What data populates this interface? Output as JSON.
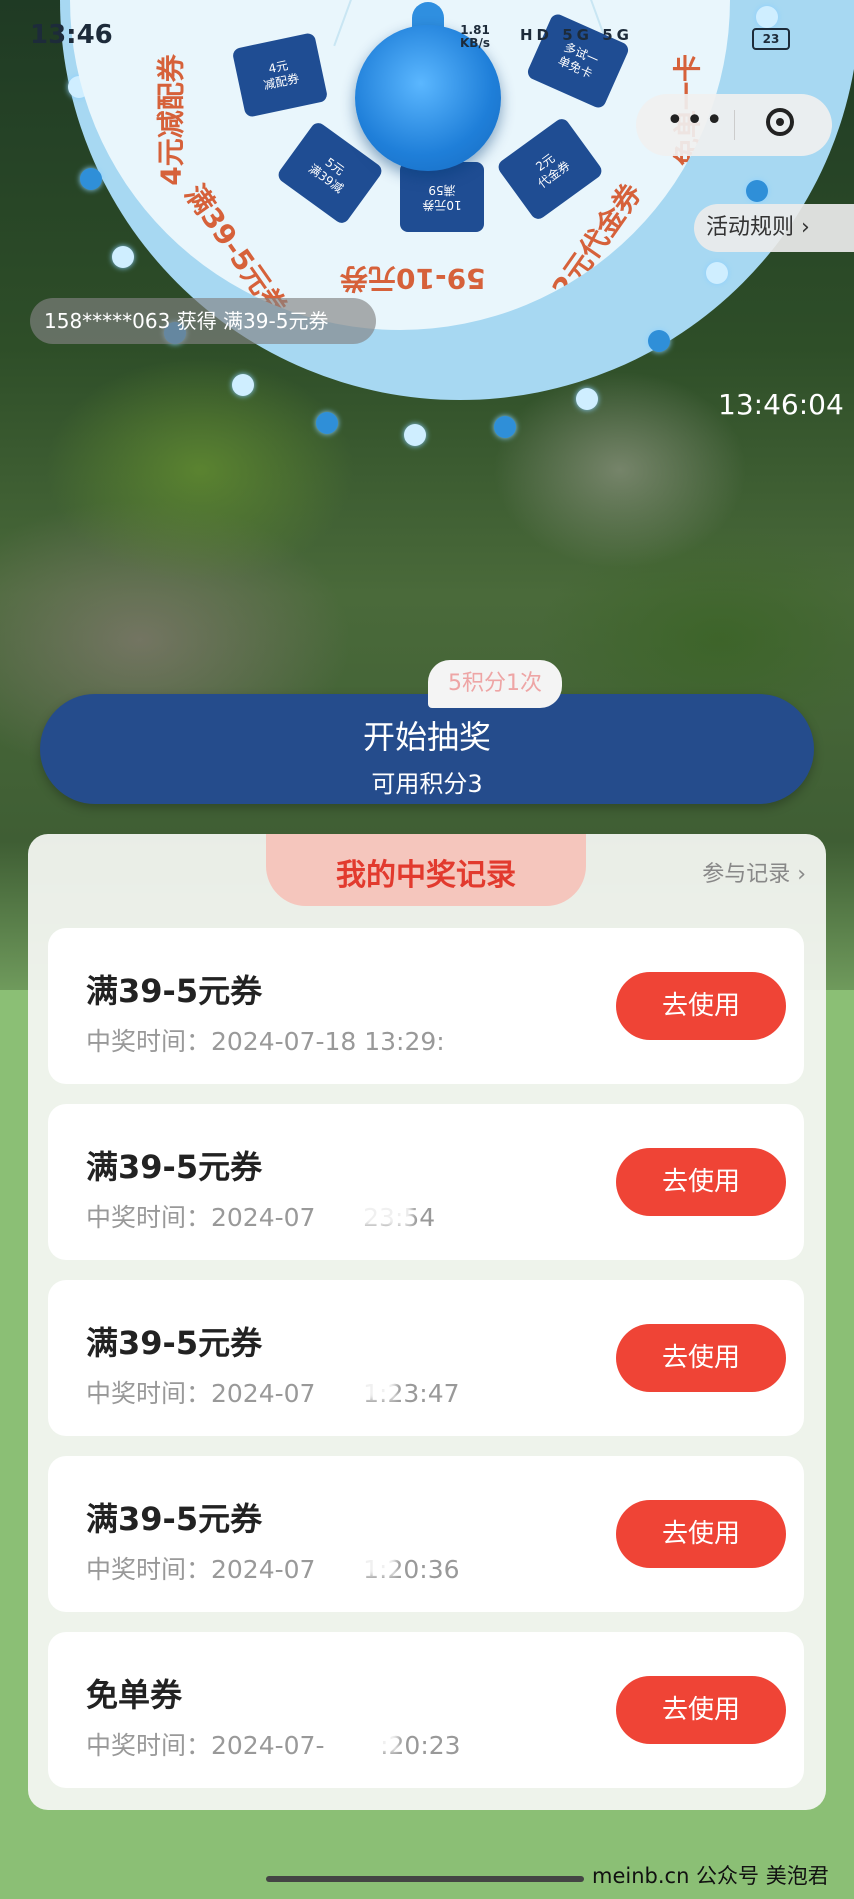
{
  "status_bar": {
    "time": "13:46",
    "net_speed": "1.81",
    "net_unit": "KB/s",
    "icons": "HD 5G 5G",
    "battery": "23"
  },
  "wheel": {
    "prizes": [
      {
        "text": "4元\n减配券"
      },
      {
        "text": "5元\n满39减"
      },
      {
        "text": "10元券\n满59"
      },
      {
        "text": "2元\n代金券"
      },
      {
        "text": "多试一\n单免卡"
      }
    ],
    "labels": [
      "4元减配券",
      "满39-5元券",
      "59-10元券",
      "2元代金券",
      "免单一卡"
    ]
  },
  "capsule": {
    "more": "•••"
  },
  "rules_label": "活动规则 ›",
  "ticker": "158*****063 获得 满39-5元券",
  "clock": "13:46:04",
  "draw": {
    "cost_tag": "5积分1次",
    "button_label": "开始抽奖",
    "points_text": "可用积分3"
  },
  "records": {
    "title": "我的中奖记录",
    "link": "参与记录 ›",
    "use_label": "去使用",
    "items": [
      {
        "name": "满39-5元券",
        "time": "中奖时间：2024-07-18 13:29:"
      },
      {
        "name": "满39-5元券",
        "time": "中奖时间：2024-07      23:54"
      },
      {
        "name": "满39-5元券",
        "time": "中奖时间：2024-07      1:23:47"
      },
      {
        "name": "满39-5元券",
        "time": "中奖时间：2024-07      1:20:36"
      },
      {
        "name": "免单券",
        "time": "中奖时间：2024-07-       :20:23"
      }
    ]
  },
  "watermark": "meinb.cn 公众号 美泡君"
}
